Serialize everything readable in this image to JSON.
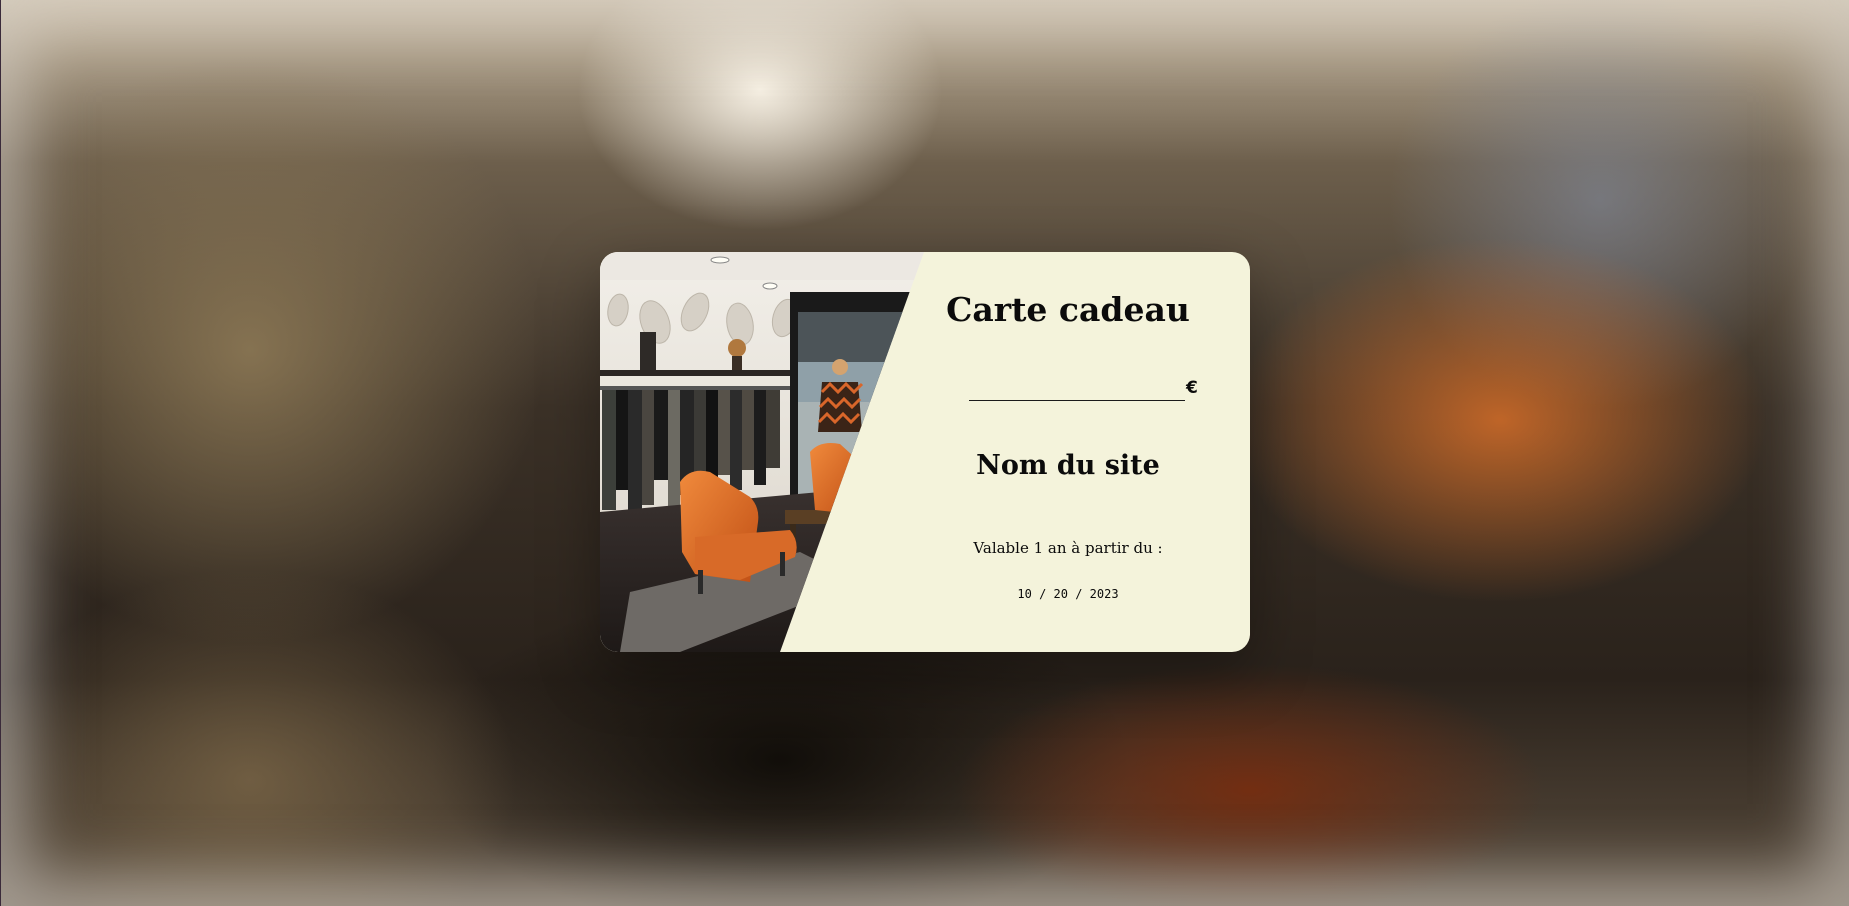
{
  "gift_card": {
    "title": "Carte cadeau",
    "amount": {
      "value": "",
      "currency_symbol": "€"
    },
    "site_name": "Nom du site",
    "validity_label": "Valable 1 an à partir du :",
    "validity_date": "10 / 20 / 2023"
  },
  "colors": {
    "card_background": "#f4f3db",
    "text": "#0b0b0b",
    "accent_chair": "#e0621f"
  },
  "icons": {
    "photo": "boutique-interior-photo"
  }
}
